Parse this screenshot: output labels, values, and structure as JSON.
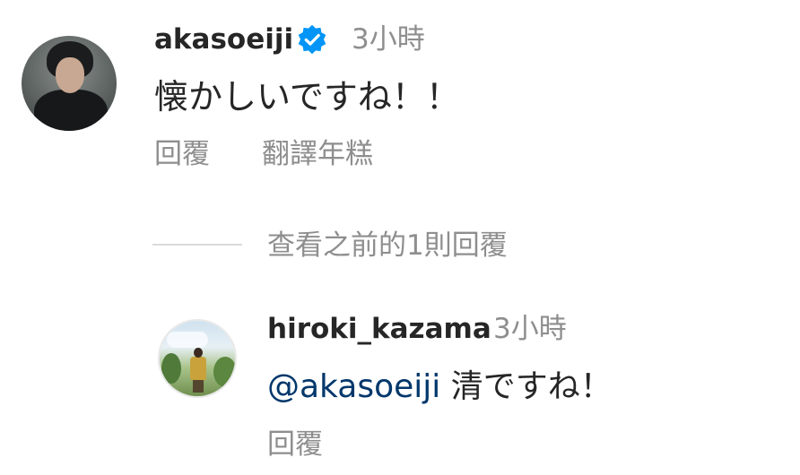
{
  "comment": {
    "username": "akasoeiji",
    "verified_icon": "verified-badge-icon",
    "timestamp": "3小時",
    "text": "懐かしいですね！！",
    "reply_label": "回覆",
    "translate_label": "翻譯年糕"
  },
  "view_previous_replies": "查看之前的1則回覆",
  "reply": {
    "username": "hiroki_kazama",
    "timestamp": "3小時",
    "mention": "@akasoeiji",
    "text": " 清ですね！",
    "reply_label": "回覆"
  },
  "colors": {
    "primary_text": "#262626",
    "secondary_text": "#8e8e8e",
    "mention": "#00376b",
    "verified": "#0095f6"
  }
}
